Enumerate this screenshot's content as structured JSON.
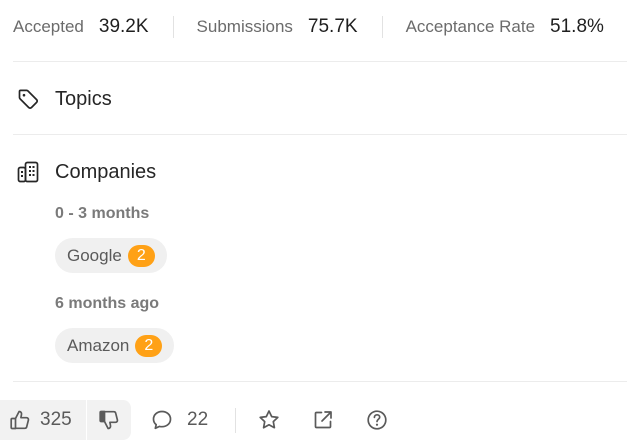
{
  "stats": {
    "accepted_label": "Accepted",
    "accepted_value": "39.2K",
    "submissions_label": "Submissions",
    "submissions_value": "75.7K",
    "acceptance_label": "Acceptance Rate",
    "acceptance_value": "51.8%"
  },
  "topics": {
    "icon": "tag-icon",
    "title": "Topics"
  },
  "companies": {
    "icon": "building-icon",
    "title": "Companies",
    "groups": [
      {
        "period": "0 - 3 months",
        "tags": [
          {
            "name": "Google",
            "count": "2"
          }
        ]
      },
      {
        "period": "6 months ago",
        "tags": [
          {
            "name": "Amazon",
            "count": "2"
          }
        ]
      }
    ]
  },
  "actions": {
    "upvotes": "325",
    "comments": "22",
    "icons": [
      "thumbs-up-icon",
      "thumbs-down-icon",
      "comment-icon",
      "star-icon",
      "share-icon",
      "help-icon"
    ]
  },
  "colors": {
    "badge": "#ffa116",
    "chip_bg": "#f0f0f0",
    "divider": "#ececec"
  }
}
